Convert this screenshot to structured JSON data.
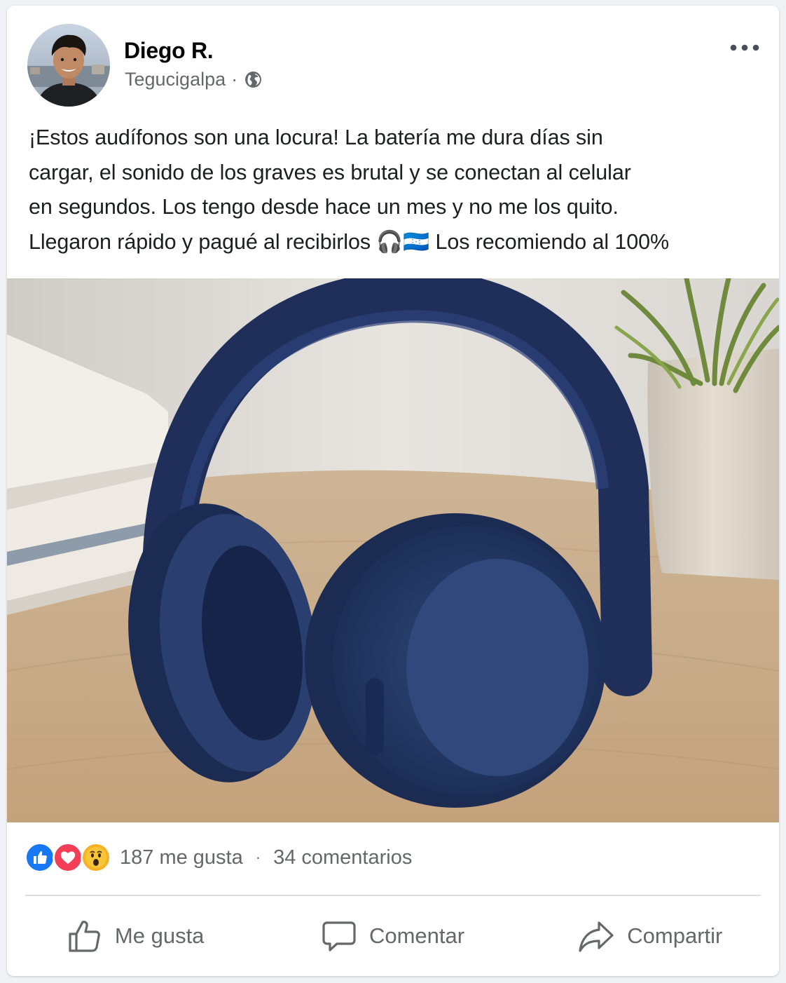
{
  "post": {
    "author": "Diego R.",
    "location": "Tegucigalpa",
    "separator": "·",
    "privacy_icon": "globe-icon",
    "more_icon": "more-options-icon",
    "text": "¡Estos audífonos son una locura! La batería me dura días sin\ncargar, el sonido de los graves es brutal y se conectan al celular\nen segundos. Los tengo desde hace un mes y no me los quito.\nLlegaron rápido y pagué al recibirlos 🎧🇭🇳 Los recomiendo al 100%"
  },
  "engagement": {
    "reactions": [
      "like-reaction-icon",
      "love-reaction-icon",
      "wow-reaction-icon"
    ],
    "likes": "187 me gusta",
    "separator": "·",
    "comments": "34 comentarios"
  },
  "actions": {
    "like": "Me gusta",
    "comment": "Comentar",
    "share": "Compartir"
  },
  "colors": {
    "like_blue": "#1877f2",
    "love_red": "#f33e58",
    "wow_yellow": "#f7b125",
    "secondary_text": "#65676b",
    "headphone_navy": "#243a6b"
  }
}
